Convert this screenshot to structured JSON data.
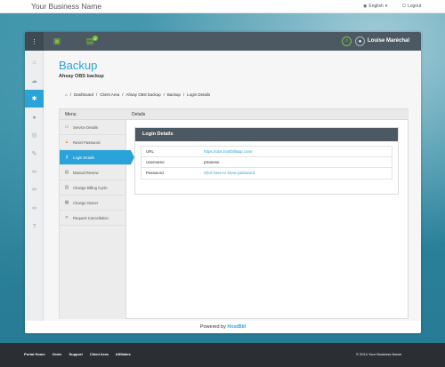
{
  "topbar": {
    "brand": "Your Business Name",
    "language": "English",
    "logout": "Logout"
  },
  "appbar": {
    "badge": "1",
    "user_name": "Louise Maréchal"
  },
  "page": {
    "title": "Backup",
    "subtitle": "Ahsay OBS backup"
  },
  "breadcrumbs": [
    "Dashboard",
    "Client Area",
    "Ahsay OBS backup",
    "Backup",
    "Login Details"
  ],
  "panel": {
    "menu_title": "Menu",
    "details_title": "Details"
  },
  "menu": [
    {
      "label": "Service Details",
      "icon": "monitor-icon"
    },
    {
      "label": "Reset Password",
      "icon": "lock-icon"
    },
    {
      "label": "Login Details",
      "icon": "key-icon",
      "active": true
    },
    {
      "label": "Manual Review",
      "icon": "review-icon"
    },
    {
      "label": "Change Billing Cycle",
      "icon": "cycle-icon"
    },
    {
      "label": "Change Owner",
      "icon": "owner-icon"
    },
    {
      "label": "Request Cancellation",
      "icon": "cancel-icon"
    }
  ],
  "login": {
    "title": "Login Details",
    "rows": [
      {
        "key": "URL",
        "value": "https://obs.hostbillapp.com/"
      },
      {
        "key": "Username",
        "value": "ptranese"
      },
      {
        "key": "Password",
        "value": "Click here to show password"
      }
    ]
  },
  "footer": {
    "powered_prefix": "Powered by",
    "powered_brand": "HostBill"
  },
  "bottom": {
    "links": [
      "Portal Home",
      "Order",
      "Support",
      "Client Area",
      "Affiliates"
    ],
    "copyright": "© 2014 Your Business Name"
  },
  "colors": {
    "accent": "#2aa3d8",
    "green": "#7bc043",
    "dark": "#4c5963"
  }
}
